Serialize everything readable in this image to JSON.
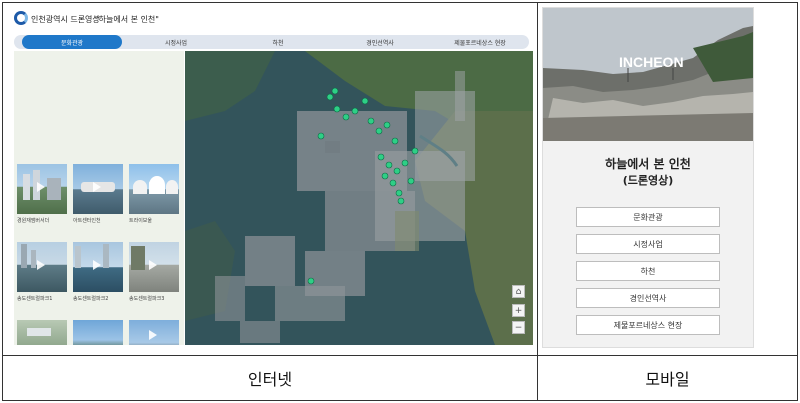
{
  "web": {
    "site_title": "인천광역시 드론영상",
    "page_title": "\"하늘에서 본 인천\"",
    "nav": [
      {
        "label": "문화관광",
        "active": true
      },
      {
        "label": "시정사업",
        "active": false
      },
      {
        "label": "하천",
        "active": false
      },
      {
        "label": "경인선역사",
        "active": false
      },
      {
        "label": "제물포르네상스 현장",
        "active": false
      }
    ],
    "videos": [
      {
        "label": "경원재앰버서더"
      },
      {
        "label": "아트센터인천"
      },
      {
        "label": "트라이보울"
      },
      {
        "label": "송도센트럴파크1"
      },
      {
        "label": "송도센트럴파크2"
      },
      {
        "label": "송도센트럴파크3"
      },
      {
        "label": ""
      },
      {
        "label": ""
      },
      {
        "label": ""
      }
    ],
    "map": {
      "marker_color": "#2ecf86",
      "zoom_in": "+",
      "zoom_out": "−"
    }
  },
  "mobile": {
    "hero_sign": "INCHEON",
    "title": "하늘에서 본 인천",
    "subtitle": "(드론영상)",
    "buttons": [
      {
        "label": "문화관광"
      },
      {
        "label": "시정사업"
      },
      {
        "label": "하천"
      },
      {
        "label": "경인선역사"
      },
      {
        "label": "제물포르네상스 현장"
      }
    ]
  },
  "captions": {
    "internet": "인터넷",
    "mobile": "모바일"
  }
}
